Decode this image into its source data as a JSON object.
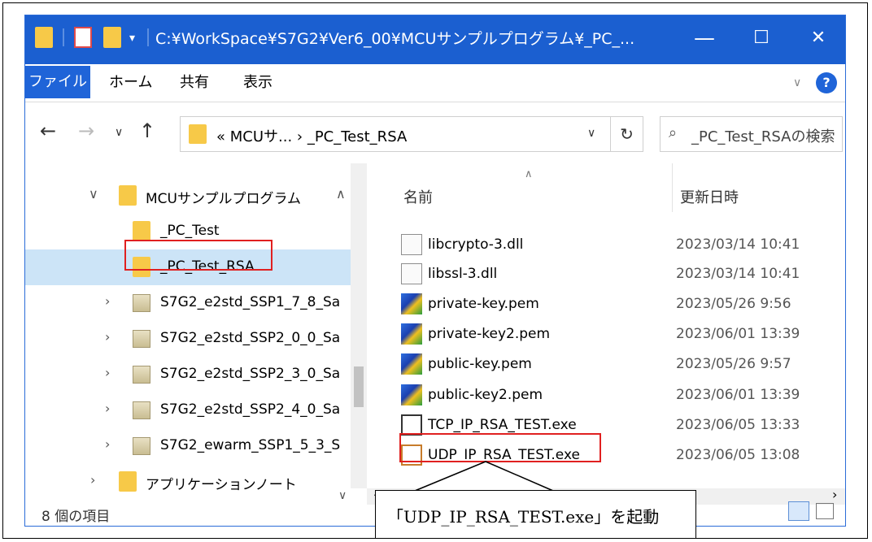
{
  "titlebar": {
    "path": "C:¥WorkSpace¥S7G2¥Ver6_00¥MCUサンプルプログラム¥_PC_...",
    "min": "—",
    "max": "☐",
    "close": "✕"
  },
  "ribbon": {
    "file": "ファイル",
    "home": "ホーム",
    "share": "共有",
    "view": "表示",
    "help": "?"
  },
  "address": {
    "text": "« MCUサ... › _PC_Test_RSA",
    "search_placeholder": "_PC_Test_RSAの検索"
  },
  "nav": {
    "items": [
      {
        "label": "MCUサンプルプログラム"
      },
      {
        "label": "_PC_Test"
      },
      {
        "label": "_PC_Test_RSA"
      },
      {
        "label": "S7G2_e2std_SSP1_7_8_Sa"
      },
      {
        "label": "S7G2_e2std_SSP2_0_0_Sa"
      },
      {
        "label": "S7G2_e2std_SSP2_3_0_Sa"
      },
      {
        "label": "S7G2_e2std_SSP2_4_0_Sa"
      },
      {
        "label": "S7G2_ewarm_SSP1_5_3_S"
      },
      {
        "label": "アプリケーションノート"
      }
    ]
  },
  "columns": {
    "name": "名前",
    "date": "更新日時"
  },
  "files": [
    {
      "name": "libcrypto-3.dll",
      "date": "2023/03/14 10:41"
    },
    {
      "name": "libssl-3.dll",
      "date": "2023/03/14 10:41"
    },
    {
      "name": "private-key.pem",
      "date": "2023/05/26 9:56"
    },
    {
      "name": "private-key2.pem",
      "date": "2023/06/01 13:39"
    },
    {
      "name": "public-key.pem",
      "date": "2023/05/26 9:57"
    },
    {
      "name": "public-key2.pem",
      "date": "2023/06/01 13:39"
    },
    {
      "name": "TCP_IP_RSA_TEST.exe",
      "date": "2023/06/05 13:33"
    },
    {
      "name": "UDP_IP_RSA_TEST.exe",
      "date": "2023/06/05 13:08"
    }
  ],
  "status": {
    "count": "8 個の項目"
  },
  "callout": {
    "text": "「UDP_IP_RSA_TEST.exe」を起動"
  },
  "colors": {
    "titlebar": "#1b5fd0",
    "highlight": "#e02020",
    "selected": "#cce4f7"
  }
}
